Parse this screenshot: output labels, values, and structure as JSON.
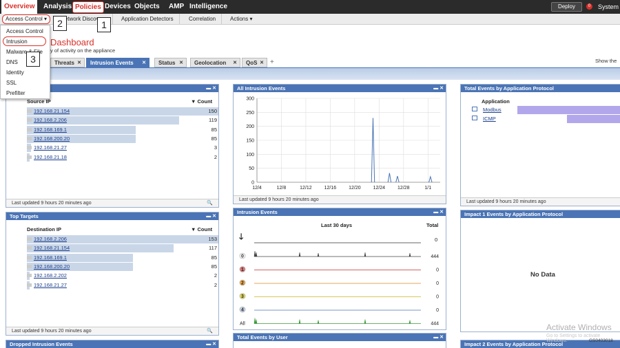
{
  "topnav": {
    "items": [
      "Overview",
      "Analysis",
      "Policies",
      "Devices",
      "Objects",
      "AMP",
      "Intelligence"
    ],
    "deploy": "Deploy",
    "system_badge": "0",
    "system": "System"
  },
  "subnav": {
    "access_control": "Access Control ▾",
    "items": [
      "Network Discovery",
      "Application Detectors",
      "Correlation",
      "Actions ▾"
    ]
  },
  "markers": [
    "1",
    "2",
    "3"
  ],
  "dropdown": {
    "items": [
      "Access Control",
      "Intrusion",
      "Malware & File",
      "DNS",
      "Identity",
      "SSL",
      "Prefilter"
    ]
  },
  "dashboard": {
    "title": "Dashboard",
    "subtitle": "y of activity on the appliance",
    "show_the": "Show the"
  },
  "tabs": [
    "Threats",
    "Intrusion Events",
    "Status",
    "Geolocation",
    "QoS"
  ],
  "tab_add": "+",
  "widgets": {
    "top_attackers": {
      "col_ip": "Source IP",
      "col_count": "▼ Count",
      "rows": [
        {
          "ip": "192.168.21.154",
          "count": 150
        },
        {
          "ip": "192.168.2.206",
          "count": 119
        },
        {
          "ip": "192.168.169.1",
          "count": 85
        },
        {
          "ip": "192.168.200.20",
          "count": 85
        },
        {
          "ip": "192.168.21.27",
          "count": 3
        },
        {
          "ip": "192.168.21.18",
          "count": 2
        }
      ],
      "footer": "Last updated 9 hours 20 minutes ago"
    },
    "top_targets": {
      "title": "Top Targets",
      "col_ip": "Destination IP",
      "col_count": "▼ Count",
      "rows": [
        {
          "ip": "192.168.2.206",
          "count": 153
        },
        {
          "ip": "192.168.21.154",
          "count": 117
        },
        {
          "ip": "192.168.169.1",
          "count": 85
        },
        {
          "ip": "192.168.200.20",
          "count": 85
        },
        {
          "ip": "192.168.2.202",
          "count": 2
        },
        {
          "ip": "192.168.21.27",
          "count": 2
        }
      ],
      "footer": "Last updated 9 hours 20 minutes ago"
    },
    "all_events": {
      "title": "All Intrusion Events",
      "footer": "Last updated 9 hours 20 minutes ago"
    },
    "intrusion_events": {
      "title": "Intrusion Events",
      "col_period": "Last 30 days",
      "col_total": "Total",
      "rows": [
        {
          "label": "0",
          "color": "#ffffff",
          "total": "444"
        },
        {
          "label": "1",
          "color": "#e07b7b",
          "total": "0"
        },
        {
          "label": "2",
          "color": "#f0a94a",
          "total": "0"
        },
        {
          "label": "3",
          "color": "#e8dc5a",
          "total": "0"
        },
        {
          "label": "4",
          "color": "#c9d6e8",
          "total": "0"
        },
        {
          "label": "All",
          "color": "",
          "total": "444"
        }
      ],
      "top_total": "0"
    },
    "app_protocol": {
      "title": "Total Events by Application Protocol",
      "col_app": "Application",
      "rows": [
        "Modbus",
        "ICMP"
      ],
      "footer": "Last updated 9 hours 20 minutes ago"
    },
    "impact1": {
      "title": "Impact 1 Events by Application Protocol",
      "no_data": "No Data"
    },
    "dropped": {
      "title": "Dropped Intrusion Events"
    },
    "by_user": {
      "title": "Total Events by User"
    },
    "impact2": {
      "title": "Impact 2 Events by Application Protocol"
    }
  },
  "watermark": "Activate Windows",
  "watermark_sub": "Go to Settings to activate Windows.",
  "figure_id": "GS0403018",
  "chart_data": {
    "type": "line",
    "x": [
      "12/4",
      "12/8",
      "12/12",
      "12/16",
      "12/20",
      "12/24",
      "12/28",
      "1/1"
    ],
    "ylim": [
      0,
      300
    ],
    "yticks": [
      0,
      50,
      100,
      150,
      200,
      250,
      300
    ],
    "series": [
      {
        "points": [
          {
            "day": 19.0,
            "value": 230
          },
          {
            "day": 21.7,
            "value": 33
          },
          {
            "day": 23.0,
            "value": 22
          },
          {
            "day": 28.4,
            "value": 20
          }
        ]
      }
    ],
    "color": "#4a74b5"
  }
}
